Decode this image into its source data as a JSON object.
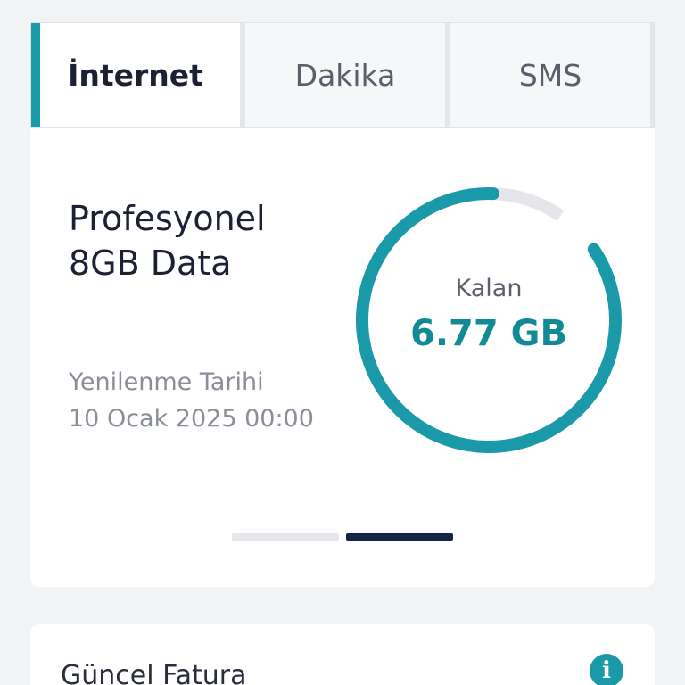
{
  "tabs": [
    {
      "label": "İnternet",
      "active": true
    },
    {
      "label": "Dakika",
      "active": false
    },
    {
      "label": "SMS",
      "active": false
    }
  ],
  "package": {
    "title": "Profesyonel 8GB Data",
    "renewal_label": "Yenilenme Tarihi",
    "renewal_date": "10 Ocak 2025 00:00"
  },
  "usage": {
    "remaining_label": "Kalan",
    "remaining_value": "6.77 GB",
    "remaining_fraction": 0.85
  },
  "pager": {
    "count": 2,
    "active_index": 1
  },
  "bill": {
    "title": "Güncel Fatura",
    "info_glyph": "i"
  },
  "colors": {
    "accent": "#1a9aa8",
    "track": "#e4e6ec",
    "pager_active": "#152446"
  }
}
